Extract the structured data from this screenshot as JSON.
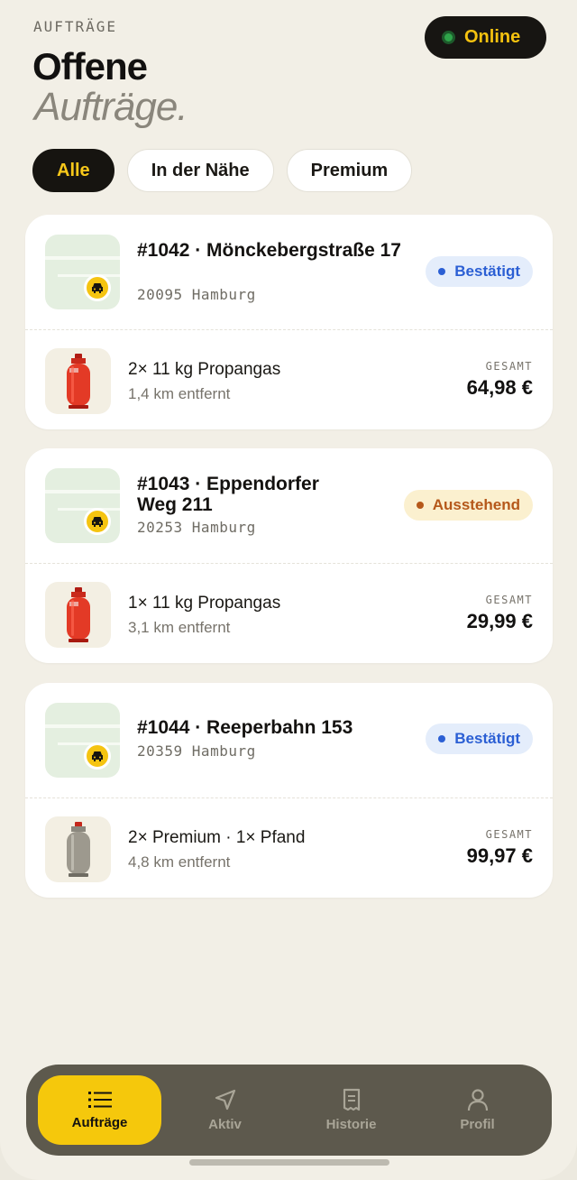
{
  "header": {
    "eyebrow": "AUFTRÄGE",
    "title_line1": "Offene",
    "title_line2": "Aufträge.",
    "status_label": "Online"
  },
  "filters": [
    {
      "label": "Alle",
      "active": true
    },
    {
      "label": "In der Nähe",
      "active": false
    },
    {
      "label": "Premium",
      "active": false
    }
  ],
  "orders": [
    {
      "title": "#1042 · Mönckebergstraße 17",
      "zip_city": "20095 Hamburg",
      "status": "Bestätigt",
      "status_color": "#2b5fd4",
      "product": "2× 11 kg Propangas",
      "distance": "1,4 km entfernt",
      "total_label": "GESAMT",
      "total": "64,98 €",
      "product_icon": "red-gas-cylinder-icon"
    },
    {
      "title": "#1043 · Eppendorfer Weg 211",
      "zip_city": "20253 Hamburg",
      "status": "Ausstehend",
      "status_color": "#b5581a",
      "product": "1× 11 kg Propangas",
      "distance": "3,1 km entfernt",
      "total_label": "GESAMT",
      "total": "29,99 €",
      "product_icon": "red-gas-cylinder-icon"
    },
    {
      "title": "#1044 · Reeperbahn 153",
      "zip_city": "20359 Hamburg",
      "status": "Bestätigt",
      "status_color": "#2b5fd4",
      "product": "2× Premium · 1× Pfand",
      "distance": "4,8 km entfernt",
      "total_label": "GESAMT",
      "total": "99,97 €",
      "product_icon": "grey-gas-cylinder-icon"
    }
  ],
  "tabbar": [
    {
      "label": "Aufträge",
      "icon": "list-icon",
      "active": true
    },
    {
      "label": "Aktiv",
      "icon": "navigation-arrow-icon",
      "active": false
    },
    {
      "label": "Historie",
      "icon": "receipt-icon",
      "active": false
    },
    {
      "label": "Profil",
      "icon": "person-icon",
      "active": false
    }
  ],
  "colors": {
    "accent": "#f5c80c",
    "background": "#f2efe6",
    "tabbar": "#5d594d",
    "online_dot": "#2fa44a"
  }
}
